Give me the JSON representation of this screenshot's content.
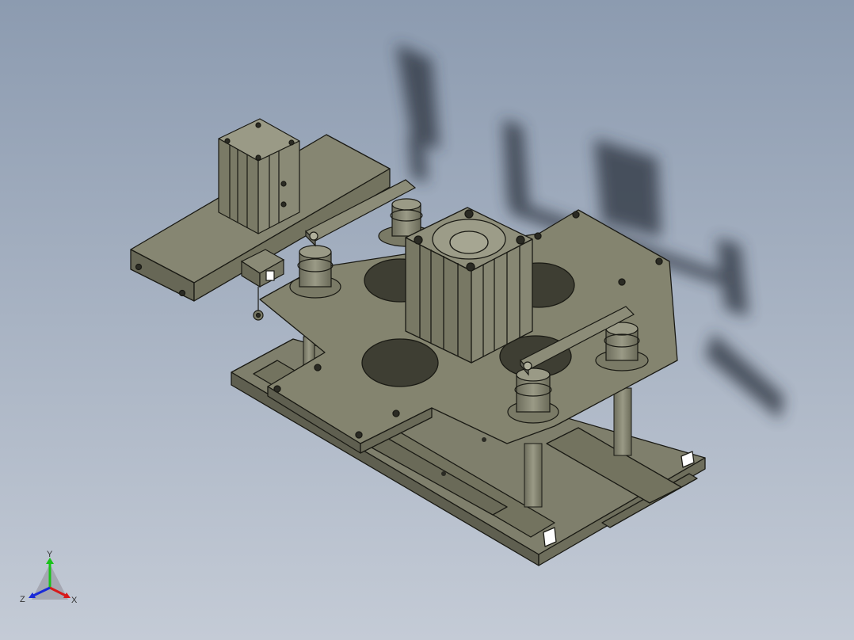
{
  "viewport": {
    "background_top": "#8c9bb0",
    "background_bottom": "#c2c9d4",
    "model_color": "#7f7f6c",
    "model_edge_color": "#1a1a14",
    "shadow_color": "#2a2f38"
  },
  "triad": {
    "y_label": "Y",
    "z_label": "Z",
    "x_label": "X",
    "y_color": "#19c219",
    "z_color": "#1a2bd8",
    "x_color": "#d81a1a"
  }
}
